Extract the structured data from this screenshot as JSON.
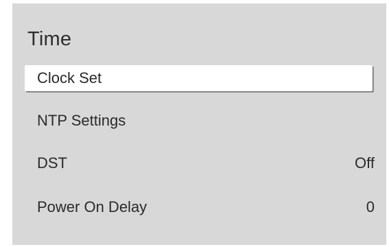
{
  "menu": {
    "title": "Time",
    "items": [
      {
        "label": "Clock Set",
        "value": "",
        "selected": true
      },
      {
        "label": "NTP Settings",
        "value": ""
      },
      {
        "label": "DST",
        "value": "Off"
      },
      {
        "label": "Power On Delay",
        "value": "0"
      }
    ]
  },
  "colors": {
    "panel_background": "#d8d8d8",
    "selected_background": "#ffffff",
    "text": "#2a2a2a"
  }
}
